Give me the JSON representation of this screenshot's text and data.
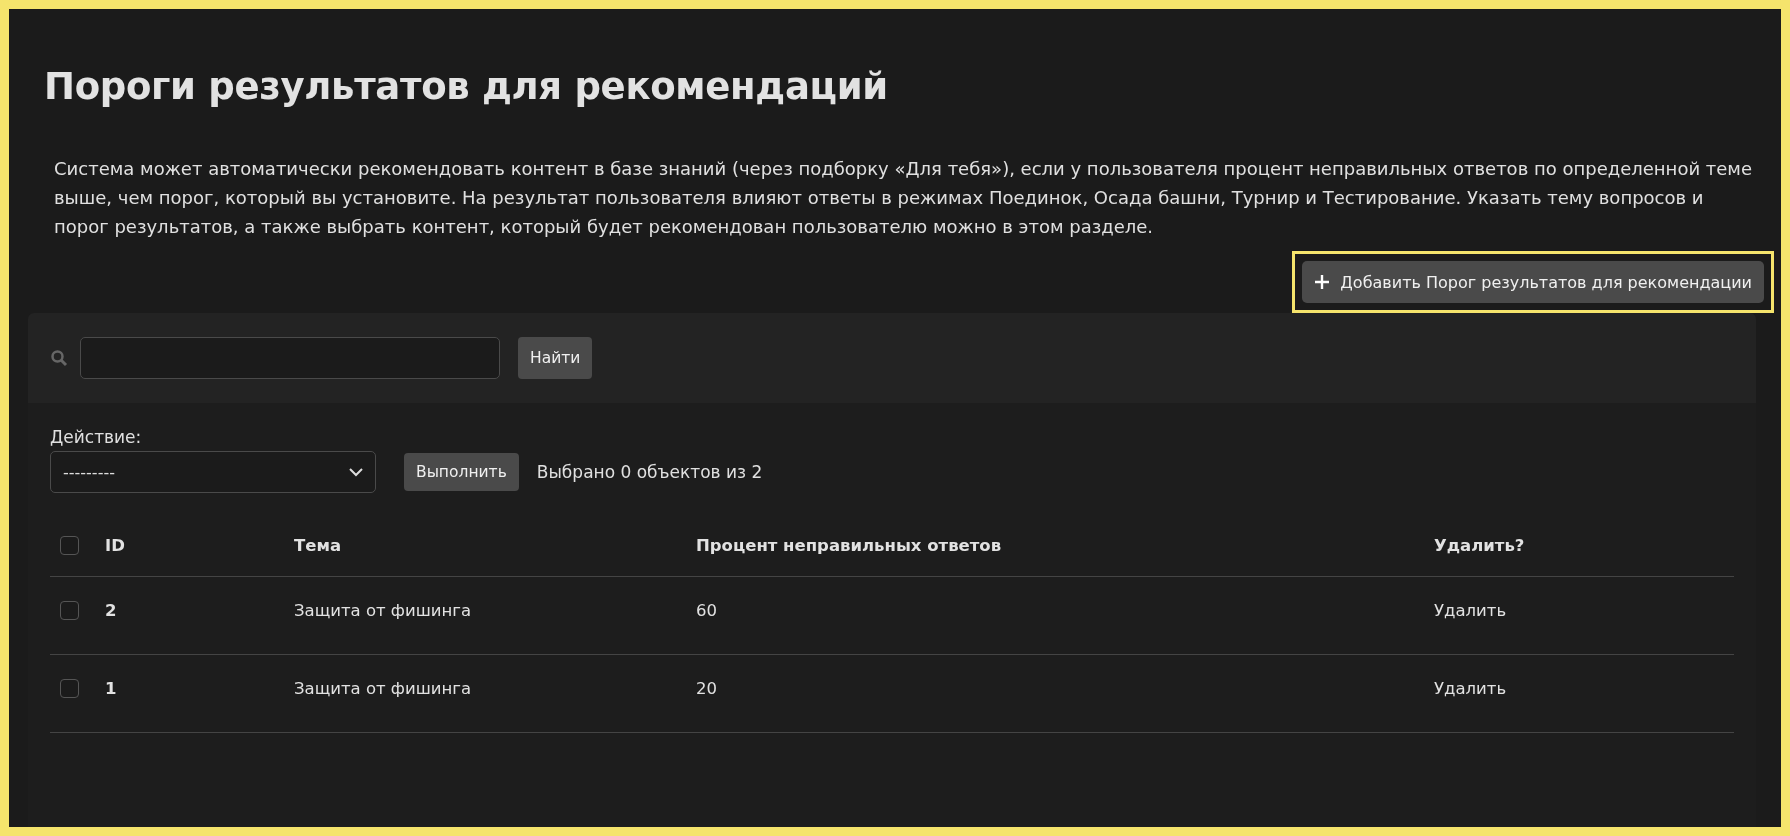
{
  "title": "Пороги результатов для рекомендаций",
  "description": "Система может автоматически рекомендовать контент в базе знаний (через подборку «Для тебя»), если у пользователя процент неправильных ответов по определенной теме выше, чем порог, который вы установите. На результат пользователя влияют ответы в режимах Поединок, Осада башни, Турнир и Тестирование. Указать тему вопросов и порог результатов, а также выбрать контент, который будет рекомендован пользователю можно в этом разделе.",
  "add_button": {
    "label": "Добавить Порог результатов для рекомендации",
    "highlighted": true
  },
  "search": {
    "button": "Найти"
  },
  "action": {
    "label": "Действие:",
    "value": "---------",
    "button": "Выполнить",
    "status": "Выбрано 0 объектов из 2"
  },
  "table": {
    "select_all_checked": false,
    "columns": [
      "ID",
      "Тема",
      "Процент неправильных ответов",
      "Удалить?"
    ],
    "rows": [
      {
        "checked": false,
        "id": "2",
        "topic": "Защита от фишинга",
        "percent": "60",
        "delete": "Удалить"
      },
      {
        "checked": false,
        "id": "1",
        "topic": "Защита от фишинга",
        "percent": "20",
        "delete": "Удалить"
      }
    ]
  }
}
